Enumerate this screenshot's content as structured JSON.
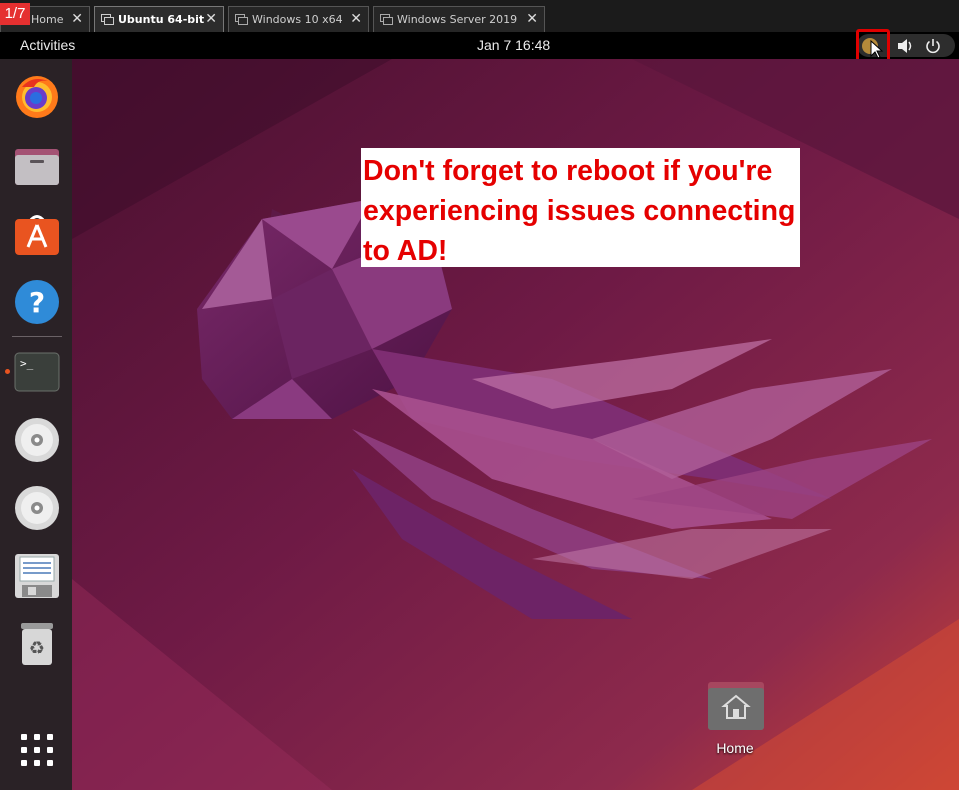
{
  "step_counter": "1/7",
  "tabs": [
    {
      "label": "Home"
    },
    {
      "label": "Ubuntu 64-bit"
    },
    {
      "label": "Windows 10 x64"
    },
    {
      "label": "Windows Server 2019"
    }
  ],
  "topbar": {
    "activities": "Activities",
    "clock": "Jan 7  16:48"
  },
  "tray_icons": [
    "network-icon",
    "volume-icon",
    "power-icon"
  ],
  "dock": [
    {
      "name": "firefox-icon"
    },
    {
      "name": "files-icon"
    },
    {
      "name": "app-center-icon"
    },
    {
      "name": "help-icon"
    },
    {
      "name": "terminal-icon"
    },
    {
      "name": "cd-drive-icon"
    },
    {
      "name": "cd-drive-icon"
    },
    {
      "name": "floppy-drive-icon"
    },
    {
      "name": "trash-icon"
    },
    {
      "name": "show-apps-icon"
    }
  ],
  "note": "Don't forget to reboot if you're experiencing issues connecting to AD!",
  "desktop": {
    "home_label": "Home"
  },
  "colors": {
    "highlight": "#e00000",
    "note_text": "#e50000",
    "ubuntu_orange": "#e95420"
  }
}
